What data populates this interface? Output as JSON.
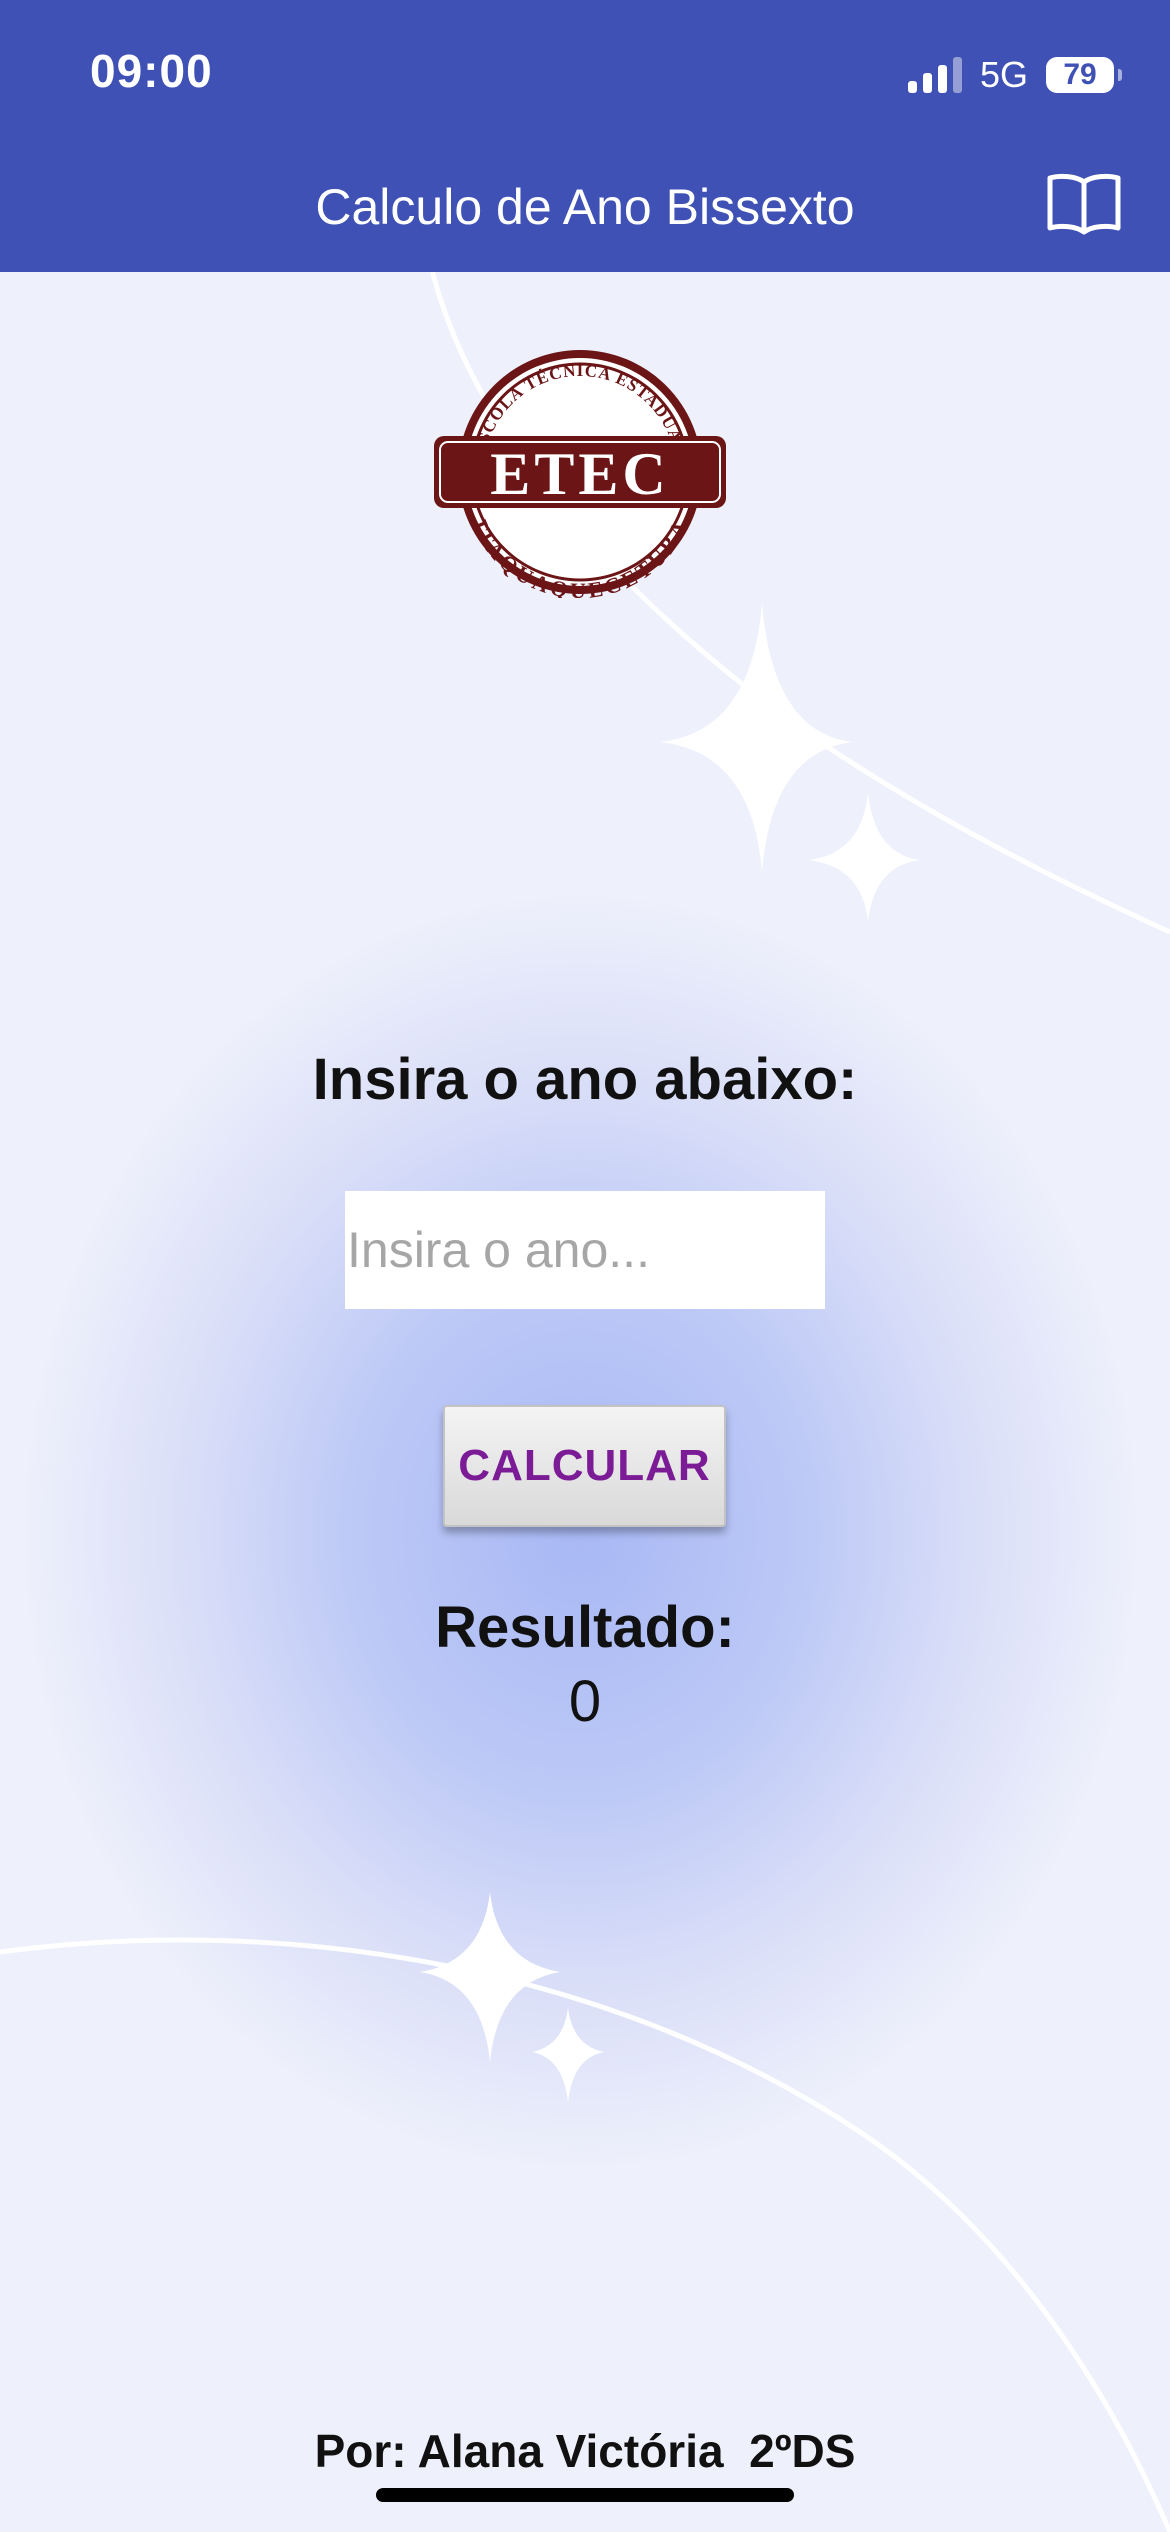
{
  "status_bar": {
    "time": "09:00",
    "network": "5G",
    "battery": "79"
  },
  "app_bar": {
    "title": "Calculo de Ano Bissexto",
    "icon": "book-icon"
  },
  "logo": {
    "text_main": "ETEC",
    "text_top": "ESCOLA TÉCNICA ESTADUAL",
    "text_bottom": "ITAQUAQUECETUBA",
    "color": "#6b1517"
  },
  "form": {
    "prompt": "Insira o ano abaixo:",
    "input_value": "",
    "input_placeholder": "Insira o ano...",
    "button_label": "CALCULAR"
  },
  "result": {
    "label": "Resultado:",
    "value": "0"
  },
  "footer": {
    "credit": "Por: Alana Victória  2ºDS"
  },
  "colors": {
    "header": "#3f51b5",
    "button_text": "#7b1b96"
  }
}
